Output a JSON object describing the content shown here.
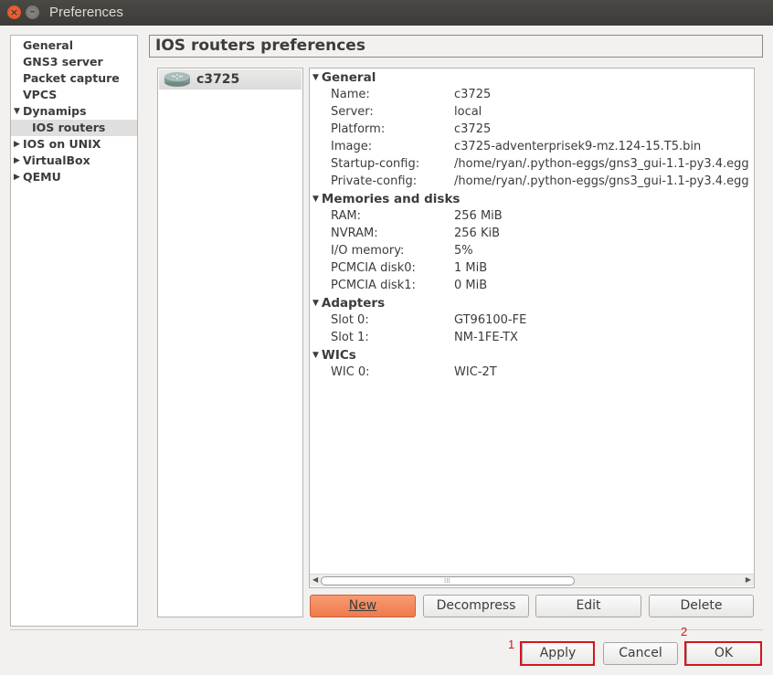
{
  "window": {
    "title": "Preferences"
  },
  "sidebar": {
    "items": [
      {
        "label": "General",
        "level": 0,
        "expandable": false
      },
      {
        "label": "GNS3 server",
        "level": 0,
        "expandable": false
      },
      {
        "label": "Packet capture",
        "level": 0,
        "expandable": false
      },
      {
        "label": "VPCS",
        "level": 0,
        "expandable": false
      },
      {
        "label": "Dynamips",
        "level": 0,
        "expandable": true,
        "expanded": true
      },
      {
        "label": "IOS routers",
        "level": 1,
        "selected": true
      },
      {
        "label": "IOS on UNIX",
        "level": 0,
        "expandable": true,
        "expanded": false
      },
      {
        "label": "VirtualBox",
        "level": 0,
        "expandable": true,
        "expanded": false
      },
      {
        "label": "QEMU",
        "level": 0,
        "expandable": true,
        "expanded": false
      }
    ]
  },
  "page": {
    "title": "IOS routers preferences"
  },
  "router_list": {
    "items": [
      {
        "name": "c3725",
        "icon": "router-icon"
      }
    ]
  },
  "details": {
    "general": {
      "title": "General",
      "rows": [
        {
          "label": "Name:",
          "value": "c3725"
        },
        {
          "label": "Server:",
          "value": "local"
        },
        {
          "label": "Platform:",
          "value": "c3725"
        },
        {
          "label": "Image:",
          "value": "c3725-adventerprisek9-mz.124-15.T5.bin"
        },
        {
          "label": "Startup-config:",
          "value": "/home/ryan/.python-eggs/gns3_gui-1.1-py3.4.egg"
        },
        {
          "label": "Private-config:",
          "value": "/home/ryan/.python-eggs/gns3_gui-1.1-py3.4.egg"
        }
      ]
    },
    "memories": {
      "title": "Memories and disks",
      "rows": [
        {
          "label": "RAM:",
          "value": "256 MiB"
        },
        {
          "label": "NVRAM:",
          "value": "256 KiB"
        },
        {
          "label": "I/O memory:",
          "value": "5%"
        },
        {
          "label": "PCMCIA disk0:",
          "value": "1 MiB"
        },
        {
          "label": "PCMCIA disk1:",
          "value": "0 MiB"
        }
      ]
    },
    "adapters": {
      "title": "Adapters",
      "rows": [
        {
          "label": "Slot 0:",
          "value": "GT96100-FE"
        },
        {
          "label": "Slot 1:",
          "value": "NM-1FE-TX"
        }
      ]
    },
    "wics": {
      "title": "WICs",
      "rows": [
        {
          "label": "WIC 0:",
          "value": "WIC-2T"
        }
      ]
    }
  },
  "actions": {
    "new": "New",
    "decompress": "Decompress",
    "edit": "Edit",
    "delete": "Delete"
  },
  "footer": {
    "apply": "Apply",
    "cancel": "Cancel",
    "ok": "OK"
  },
  "annotations": {
    "apply_marker": "1",
    "ok_marker": "2"
  },
  "colors": {
    "accent": "#ef7a4c",
    "highlight": "#d8141c"
  }
}
